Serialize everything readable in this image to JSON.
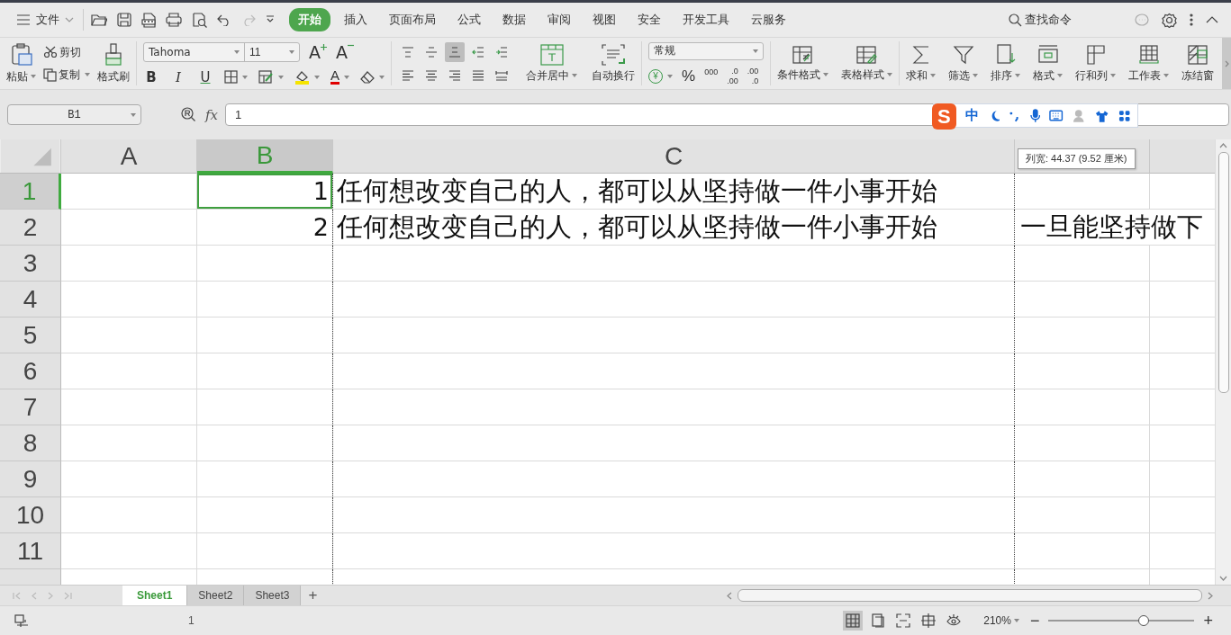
{
  "menu": {
    "label": "文件"
  },
  "tabs": [
    {
      "label": "开始",
      "selected": true
    },
    {
      "label": "插入",
      "selected": false
    },
    {
      "label": "页面布局",
      "selected": false
    },
    {
      "label": "公式",
      "selected": false
    },
    {
      "label": "数据",
      "selected": false
    },
    {
      "label": "审阅",
      "selected": false
    },
    {
      "label": "视图",
      "selected": false
    },
    {
      "label": "安全",
      "selected": false
    },
    {
      "label": "开发工具",
      "selected": false
    },
    {
      "label": "云服务",
      "selected": false
    }
  ],
  "search": {
    "label": "查找命令"
  },
  "ribbon": {
    "paste": "粘贴",
    "cut": "剪切",
    "copy": "复制",
    "format_painter": "格式刷",
    "font_name": "Tahoma",
    "font_size": "11",
    "grow_font": "A",
    "shrink_font": "A",
    "bold": "B",
    "italic": "I",
    "underline": "U",
    "font_color": "A",
    "align_buttons": [
      {
        "kind": "top",
        "selected": false
      },
      {
        "kind": "middle",
        "selected": false
      },
      {
        "kind": "bottom",
        "selected": true
      },
      {
        "kind": "outdent",
        "selected": false
      },
      {
        "kind": "indent",
        "selected": false
      },
      {
        "kind": "left",
        "selected": false
      },
      {
        "kind": "center",
        "selected": false
      },
      {
        "kind": "right",
        "selected": false
      },
      {
        "kind": "justify",
        "selected": false
      },
      {
        "kind": "distribute",
        "selected": false
      }
    ],
    "merge": "合并居中",
    "wrap": "自动换行",
    "number_format": "常规",
    "currency": "¥",
    "percent": "%",
    "thousands": "000",
    "increase_decimal": [
      ".0",
      ".00"
    ],
    "decrease_decimal": [
      ".00",
      ".0"
    ],
    "styles": [
      "条件格式",
      "表格样式"
    ],
    "tools": [
      "求和",
      "筛选",
      "排序",
      "格式",
      "行和列",
      "工作表",
      "冻结窗"
    ]
  },
  "formula_bar": {
    "name_box": "B1",
    "fx": "fx",
    "value": "1"
  },
  "ime": {
    "logo": "S",
    "mode": "中"
  },
  "columns": [
    {
      "label": "A",
      "selected": false
    },
    {
      "label": "B",
      "selected": true
    },
    {
      "label": "C",
      "selected": false
    }
  ],
  "tooltip": "列宽: 44.37 (9.52 厘米)",
  "rows": [
    {
      "number": "1",
      "selected": true,
      "cells": {
        "B": "1",
        "C": "任何想改变自己的人，都可以从坚持做一件小事开始"
      }
    },
    {
      "number": "2",
      "selected": false,
      "cells": {
        "B": "2",
        "C": "任何想改变自己的人，都可以从坚持做一件小事开始",
        "D": "一旦能坚持做下"
      }
    },
    {
      "number": "3",
      "selected": false,
      "cells": {}
    },
    {
      "number": "4",
      "selected": false,
      "cells": {}
    },
    {
      "number": "5",
      "selected": false,
      "cells": {}
    },
    {
      "number": "6",
      "selected": false,
      "cells": {}
    },
    {
      "number": "7",
      "selected": false,
      "cells": {}
    },
    {
      "number": "8",
      "selected": false,
      "cells": {}
    },
    {
      "number": "9",
      "selected": false,
      "cells": {}
    },
    {
      "number": "10",
      "selected": false,
      "cells": {}
    },
    {
      "number": "11",
      "selected": false,
      "cells": {}
    }
  ],
  "sheets": [
    {
      "name": "Sheet1",
      "selected": true
    },
    {
      "name": "Sheet2",
      "selected": false
    },
    {
      "name": "Sheet3",
      "selected": false
    }
  ],
  "add_sheet": "+",
  "status": {
    "value": "1",
    "views": [
      {
        "kind": "normal",
        "selected": true
      },
      {
        "kind": "page",
        "selected": false
      },
      {
        "kind": "break",
        "selected": false
      },
      {
        "kind": "reading",
        "selected": false
      },
      {
        "kind": "eye",
        "selected": false
      }
    ],
    "zoom": "210%",
    "zoom_out": "−",
    "zoom_in": "+",
    "level": 0.65
  }
}
